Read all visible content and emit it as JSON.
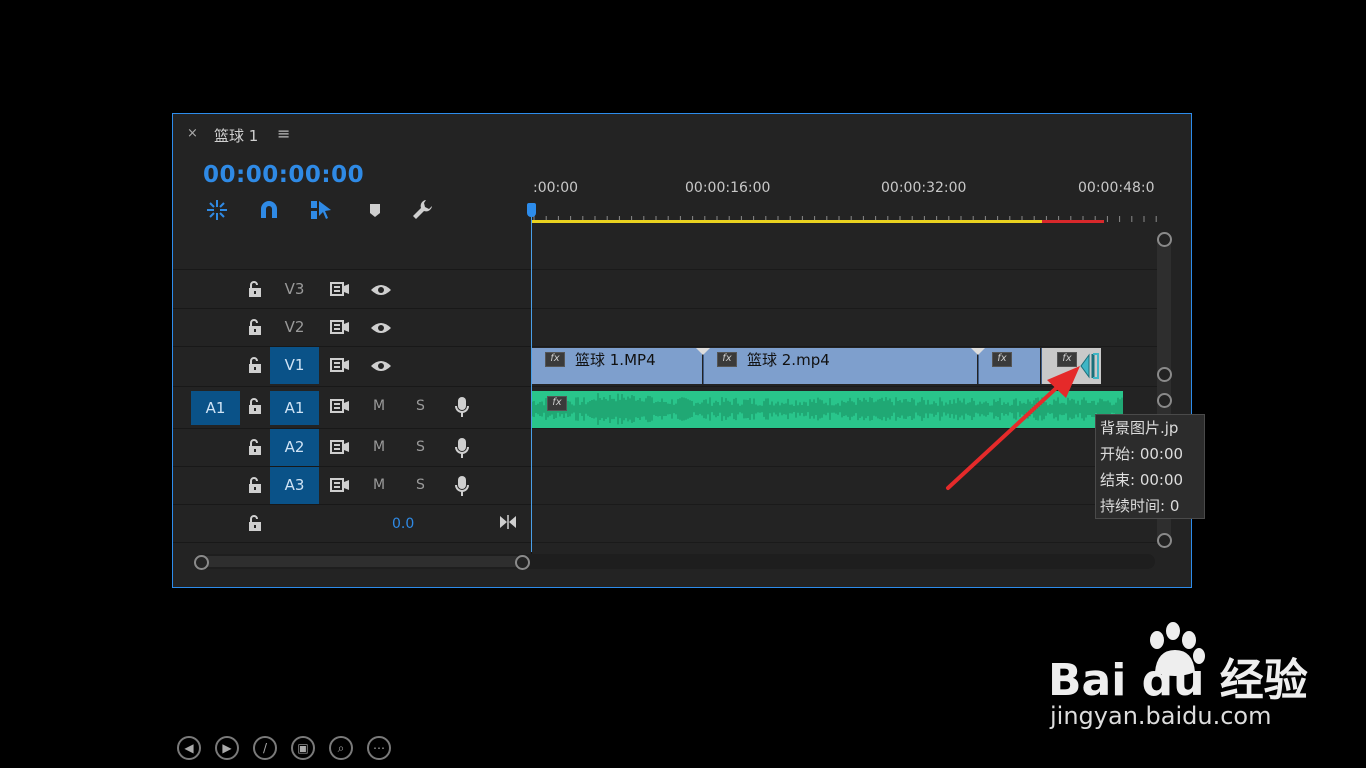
{
  "panel": {
    "tab": {
      "close": "×",
      "title": "篮球 1",
      "menu": "≡"
    },
    "timecode": "00:00:00:00",
    "tools": [
      {
        "name": "insert-overwrite-icon"
      },
      {
        "name": "snap-magnet-icon"
      },
      {
        "name": "linked-selection-icon"
      },
      {
        "name": "add-marker-icon"
      },
      {
        "name": "settings-wrench-icon"
      }
    ],
    "ruler": {
      "labels": [
        ":00:00",
        "00:00:16:00",
        "00:00:32:00",
        "00:00:48:0"
      ]
    },
    "video_tracks": [
      {
        "id": "V3",
        "target": "V3",
        "targeted": false
      },
      {
        "id": "V2",
        "target": "V2",
        "targeted": false
      },
      {
        "id": "V1",
        "target": "V1",
        "targeted": true
      }
    ],
    "audio_tracks": [
      {
        "id": "A1",
        "source": "A1",
        "target": "A1",
        "m": "M",
        "s": "S"
      },
      {
        "id": "A2",
        "source": "",
        "target": "A2",
        "m": "M",
        "s": "S"
      },
      {
        "id": "A3",
        "source": "",
        "target": "A3",
        "m": "M",
        "s": "S"
      }
    ],
    "master": {
      "volume": "0.0"
    },
    "clips": [
      {
        "name": "篮球 1.MP4",
        "fx": "fx"
      },
      {
        "name": "篮球 2.mp4",
        "fx": "fx"
      },
      {
        "name": "",
        "fx": "fx"
      },
      {
        "name": "",
        "fx": "fx"
      }
    ],
    "audio_clip": {
      "fx": "fx"
    },
    "tooltip": {
      "line1": "背景图片.jp",
      "line2": "开始: 00:00",
      "line3": "结束: 00:00",
      "line4": "持续时间: 0"
    }
  },
  "bottom_nav": [
    {
      "name": "previous-slide-icon",
      "glyph": "◀"
    },
    {
      "name": "next-slide-icon",
      "glyph": "▶"
    },
    {
      "name": "pen-icon",
      "glyph": "/"
    },
    {
      "name": "slides-icon",
      "glyph": "▣"
    },
    {
      "name": "zoom-icon",
      "glyph": "⌕"
    },
    {
      "name": "more-icon",
      "glyph": "⋯"
    }
  ],
  "watermark": {
    "brand": "Bai du 经验",
    "url": "jingyan.baidu.com"
  },
  "colors": {
    "accent": "#2d8ceb",
    "video_clip": "#7e9fcd",
    "audio_clip": "#29c58b",
    "target_on": "#0a5288"
  }
}
